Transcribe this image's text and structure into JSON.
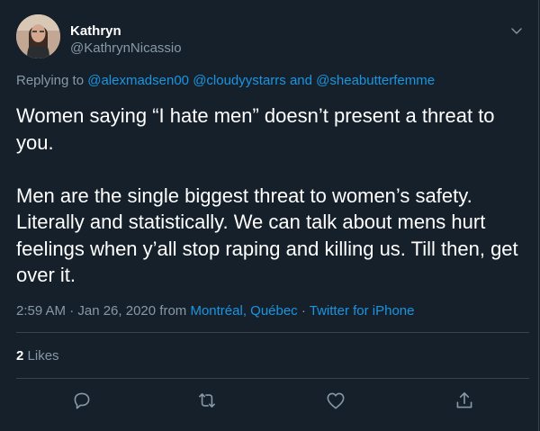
{
  "author": {
    "display_name": "Kathryn",
    "handle": "@KathrynNicassio"
  },
  "replying": {
    "prefix": "Replying to",
    "users": [
      "@alexmadsen00",
      "@cloudyystarrs",
      "@sheabutterfemme"
    ],
    "conjunction": "and"
  },
  "tweet": {
    "paragraph_1": "Women saying “I hate men” doesn’t present a threat to you.",
    "paragraph_2": "Men are the single biggest threat to women’s safety. Literally and statistically. We can talk about mens hurt feelings when y’all stop raping and killing us. Till then, get over it."
  },
  "meta": {
    "timestamp": "2:59 AM · Jan 26, 2020",
    "from_label": "from",
    "location": "Montréal, Québec",
    "separator": "·",
    "source": "Twitter for iPhone"
  },
  "engagement": {
    "likes_count": "2",
    "likes_label": "Likes"
  },
  "actions": {
    "icons": [
      "reply-icon",
      "retweet-icon",
      "like-icon",
      "share-icon"
    ]
  },
  "colors": {
    "background": "#15202b",
    "text": "#ffffff",
    "secondary_text": "#8899a6",
    "link": "#1b95e0",
    "border": "#38444d"
  }
}
